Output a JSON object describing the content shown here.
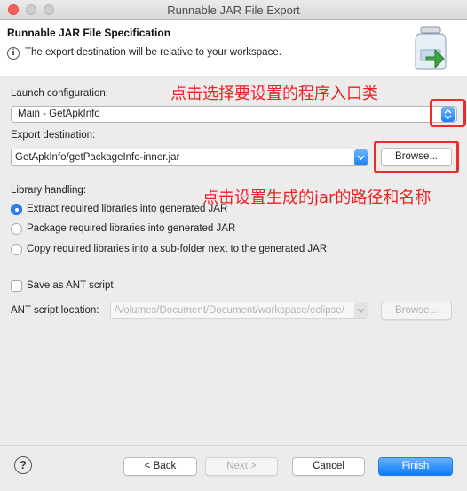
{
  "window": {
    "title": "Runnable JAR File Export"
  },
  "header": {
    "title": "Runnable JAR File Specification",
    "message": "The export destination will be relative to your workspace."
  },
  "launch": {
    "label": "Launch configuration:",
    "value": "Main - GetApkInfo"
  },
  "export": {
    "label": "Export destination:",
    "value": "GetApkInfo/getPackageInfo-inner.jar",
    "browse": "Browse..."
  },
  "library": {
    "label": "Library handling:",
    "options": [
      "Extract required libraries into generated JAR",
      "Package required libraries into generated JAR",
      "Copy required libraries into a sub-folder next to the generated JAR"
    ]
  },
  "ant": {
    "save_label": "Save as ANT script",
    "location_label": "ANT script location:",
    "location_value": "/Volumes/Document/Document/workspace/eclipse/",
    "browse": "Browse..."
  },
  "annotations": {
    "launch": "点击选择要设置的程序入口类",
    "export": "点击设置生成的jar的路径和名称"
  },
  "footer": {
    "help": "?",
    "back": "< Back",
    "next": "Next >",
    "cancel": "Cancel",
    "finish": "Finish"
  },
  "colors": {
    "annotation": "#ec2b2b",
    "accent": "#1a82fb"
  }
}
